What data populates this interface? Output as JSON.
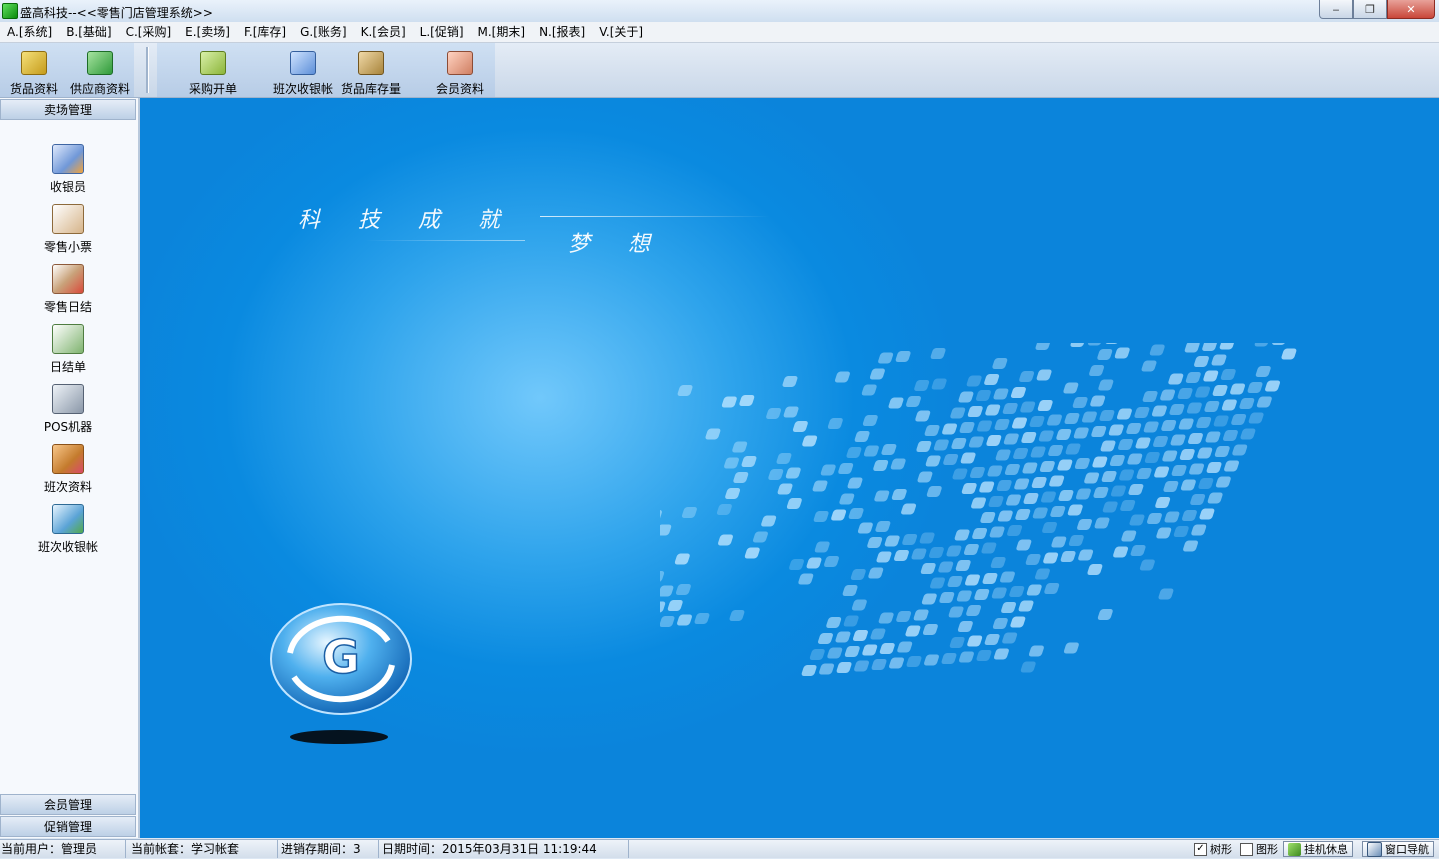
{
  "window": {
    "title": "盛高科技--<<零售门店管理系统>>",
    "controls": [
      "‒",
      "❐",
      "✕"
    ]
  },
  "menu": [
    "A.[系统]",
    "B.[基础]",
    "C.[采购]",
    "E.[卖场]",
    "F.[库存]",
    "G.[账务]",
    "K.[会员]",
    "L.[促销]",
    "M.[期末]",
    "N.[报表]",
    "V.[关于]"
  ],
  "toolbar": {
    "goods": "货品资料",
    "supplier": "供应商资料",
    "purchase": "采购开单",
    "shift_account": "班次收银帐",
    "stock": "货品库存量",
    "member": "会员资料"
  },
  "sidebar": {
    "header": "卖场管理",
    "items": [
      "收银员",
      "零售小票",
      "零售日结",
      "日结单",
      "POS机器",
      "班次资料",
      "班次收银帐"
    ],
    "bottom": [
      "会员管理",
      "促销管理"
    ]
  },
  "banner": {
    "line1": "科技成就",
    "line2": "梦想",
    "logo_letter": "G"
  },
  "status": {
    "user": "当前用户：管理员",
    "account": "当前帐套：学习帐套",
    "period": "进销存期间：3",
    "datetime": "日期时间：2015年03月31日 11:19:44",
    "tree_label": "树形",
    "graph_label": "图形",
    "standby": "挂机休息",
    "nav": "窗口导航",
    "tree_checked": "✓"
  },
  "colors": {
    "accent": "#0b84db",
    "title_bar": "#cfdff0"
  }
}
